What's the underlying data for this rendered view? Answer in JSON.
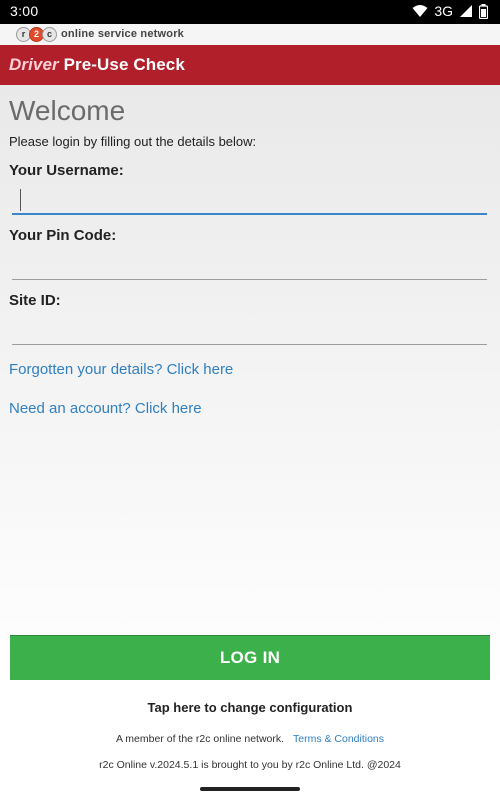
{
  "status_bar": {
    "time": "3:00",
    "network": "3G",
    "icons": [
      "wifi-icon",
      "signal-icon",
      "battery-icon"
    ]
  },
  "brand_strip": {
    "logo_letters": [
      "r",
      "2",
      "c"
    ],
    "text": "online service network"
  },
  "app_bar": {
    "title_part1": "Driver",
    "title_part2": " Pre-Use Check",
    "color": "#b11f2b"
  },
  "welcome": {
    "title": "Welcome",
    "intro": "Please login by filling out the details below:"
  },
  "form": {
    "username_label": "Your Username:",
    "username_value": "",
    "pin_label": "Your Pin Code:",
    "pin_value": "",
    "site_label": "Site ID:",
    "site_value": ""
  },
  "links": {
    "forgot": "Forgotten your details? Click here",
    "account": "Need an account? Click here"
  },
  "footer": {
    "login_label": "LOG IN",
    "login_color": "#3cb04a",
    "config": "Tap here to change configuration",
    "member": "A member of the r2c online network.",
    "terms": "Terms & Conditions",
    "version": "r2c Online v.2024.5.1 is brought to you by r2c Online Ltd. @2024"
  }
}
